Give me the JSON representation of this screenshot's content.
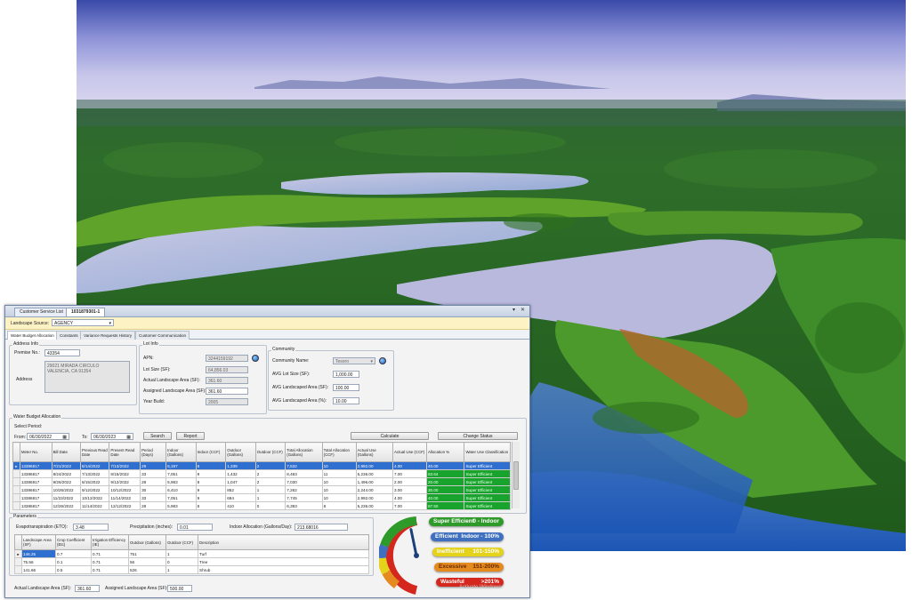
{
  "app": {
    "tabs": [
      "Customer Service List",
      "1031879301-1"
    ],
    "window_controls": {
      "down": "▾",
      "close": "✕"
    }
  },
  "source": {
    "label": "Landscape Source:",
    "value": "AGENCY"
  },
  "subtabs": [
    "Water Budget Allocation",
    "Constants",
    "Variance Requests History",
    "Customer Communication"
  ],
  "address_info": {
    "title": "Address Info",
    "premise_label": "Premise No.:",
    "premise_value": "43354",
    "address_label": "Address",
    "address_line1": "29021 MIRADA CIRCULO",
    "address_line2": "VALENCIA, CA 91354"
  },
  "lot_info": {
    "title": "Lot Info",
    "apn_label": "APN:",
    "apn_value": "3244159192",
    "lot_size_label": "Lot Size (SF):",
    "lot_size_value": "64,856.03",
    "actual_area_label": "Actual Landscape Area (SF):",
    "actual_area_value": "361.60",
    "assigned_area_label": "Assigned Landscape Area (SF):",
    "assigned_area_value": "361.60",
    "year_built_label": "Year Build:",
    "year_built_value": "2005"
  },
  "community": {
    "title": "Community",
    "name_label": "Community Name:",
    "name_value": "Tesoro",
    "avg_lot_label": "AVG Lot Size (SF):",
    "avg_lot_value": "1,000.00",
    "avg_area_label": "AVG Landscaped Area (SF):",
    "avg_area_value": "100.00",
    "avg_pct_label": "AVG Landscaped Area (%):",
    "avg_pct_value": "10.00"
  },
  "wba": {
    "title": "Water Budget Allocation",
    "select_period_label": "Select Period:",
    "from_label": "From:",
    "from_value": "06/30/2022",
    "to_label": "To:",
    "to_value": "06/30/2023",
    "search_label": "Search",
    "report_label": "Report",
    "calculate_label": "Calculate",
    "change_status_label": "Change Status",
    "columns": [
      "Meter No.",
      "Bill Date",
      "Previous Read Date",
      "Present Read Date",
      "Period (Days)",
      "Indoor (Gallons)",
      "Indoor (CCF)",
      "Outdoor (Gallons)",
      "Outdoor (CCF)",
      "Total Allocation (Gallons)",
      "Total Allocation (CCF)",
      "Actual Use (Gallons)",
      "Actual Use (CCF)",
      "Allocation %",
      "Water Use Classification"
    ],
    "rows": [
      [
        "13386817",
        "7/21/2022",
        "6/14/2022",
        "7/13/2022",
        "29",
        "6,197",
        "8",
        "1,339",
        "2",
        "7,532",
        "10",
        "2,992.00",
        "4.00",
        "40.00",
        "Super Efficient"
      ],
      [
        "13386817",
        "8/24/2022",
        "7/13/2022",
        "8/15/2022",
        "33",
        "7,051",
        "9",
        "1,432",
        "2",
        "8,483",
        "11",
        "5,236.00",
        "7.00",
        "63.64",
        "Super Efficient"
      ],
      [
        "13386817",
        "9/26/2022",
        "8/15/2022",
        "9/12/2022",
        "28",
        "5,983",
        "8",
        "1,047",
        "2",
        "7,030",
        "10",
        "1,496.00",
        "2.00",
        "20.00",
        "Super Efficient"
      ],
      [
        "13386817",
        "10/26/2022",
        "9/12/2022",
        "10/12/2022",
        "30",
        "6,410",
        "9",
        "852",
        "1",
        "7,262",
        "10",
        "2,244.00",
        "3.00",
        "30.00",
        "Super Efficient"
      ],
      [
        "13386817",
        "11/23/2022",
        "10/12/2022",
        "11/14/2022",
        "33",
        "7,051",
        "9",
        "694",
        "1",
        "7,745",
        "10",
        "2,992.00",
        "4.00",
        "40.00",
        "Super Efficient"
      ],
      [
        "13386817",
        "12/26/2022",
        "11/14/2022",
        "12/12/2022",
        "28",
        "5,983",
        "8",
        "410",
        "0",
        "6,393",
        "8",
        "5,236.00",
        "7.00",
        "87.50",
        "Super Efficient"
      ]
    ]
  },
  "parameters": {
    "title": "Parameters",
    "eto_label": "Evapotranspiration (ETO):",
    "eto_value": "3.48",
    "precip_label": "Precipitation (inches):",
    "precip_value": "0.01",
    "indoor_label": "Indoor Allocation (Gallons/Day):",
    "indoor_value": "213.68016",
    "columns": [
      "Landscape Area (SF)",
      "Crop Coefficient (Etc)",
      "Irrigation Efficiency (IE)",
      "Outdoor (Gallons)",
      "Outdoor (CCF)",
      "Description"
    ],
    "rows": [
      [
        "146.25",
        "0.7",
        "0.71",
        "751",
        "1",
        "Turf"
      ],
      [
        "75.56",
        "0.1",
        "0.71",
        "56",
        "0",
        "Tree"
      ],
      [
        "141.66",
        "0.5",
        "0.71",
        "526",
        "1",
        "Shrub"
      ]
    ],
    "actual_area_label": "Actual Landscape Area (SF):",
    "actual_area_value": "361.60",
    "assigned_area_label": "Assigned Landscape Area (SF):",
    "assigned_area_value": "500.00"
  },
  "classification": {
    "gauge_percent": 40,
    "items": [
      {
        "name": "Super Efficient",
        "range": "0 - Indoor",
        "color": "#2e9a2a",
        "text_color": "#ffffff"
      },
      {
        "name": "Efficient",
        "range": "Indoor - 100%",
        "color": "#3f6fbf",
        "text_color": "#ffffff"
      },
      {
        "name": "Inefficient",
        "range": "101-150%",
        "color": "#e4d21b",
        "text_color": "#ffffff"
      },
      {
        "name": "Excessive",
        "range": "151-200%",
        "color": "#e58a1f",
        "text_color": "#6a2a00"
      },
      {
        "name": "Wasteful",
        "range": ">201%",
        "color": "#d4281f",
        "text_color": "#ffffff"
      }
    ],
    "watermark": "Activate Windows"
  }
}
